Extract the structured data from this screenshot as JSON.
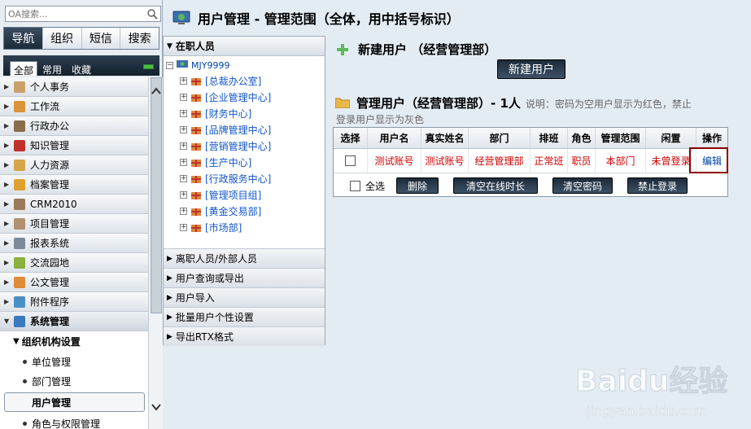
{
  "sidebar": {
    "search_placeholder": "OA搜索...",
    "main_tabs": [
      "导航",
      "组织",
      "短信",
      "搜索"
    ],
    "sub_tabs": [
      "全部",
      "常用",
      "收藏"
    ],
    "menu_items": [
      "个人事务",
      "工作流",
      "行政办公",
      "知识管理",
      "人力资源",
      "档案管理",
      "CRM2010",
      "项目管理",
      "报表系统",
      "交流园地",
      "公文管理",
      "附件程序",
      "系统管理"
    ],
    "sub_header": "组织机构设置",
    "sub_items": [
      "单位管理",
      "部门管理",
      "用户管理",
      "角色与权限管理"
    ]
  },
  "header": {
    "title": "用户管理 - 管理范围（全体，用中括号标识）"
  },
  "tree": {
    "header": "在职人员",
    "root": "MJY9999",
    "depts": [
      "[总裁办公室]",
      "[企业管理中心]",
      "[财务中心]",
      "[品牌管理中心]",
      "[营销管理中心]",
      "[生产中心]",
      "[行政服务中心]",
      "[管理项目组]",
      "[黄金交易部]",
      "[市场部]"
    ],
    "collapsed": [
      "离职人员/外部人员",
      "用户查询或导出",
      "用户导入",
      "批量用户个性设置",
      "导出RTX格式"
    ]
  },
  "new_user": {
    "title": "新建用户 （经营管理部）",
    "button": "新建用户"
  },
  "manage": {
    "title": "管理用户（经营管理部）- 1人",
    "note_line1": "说明：密码为空用户显示为红色，禁止",
    "note_line2": "登录用户显示为灰色",
    "columns": [
      "选择",
      "用户名",
      "真实姓名",
      "部门",
      "排班",
      "角色",
      "管理范围",
      "闲置",
      "操作"
    ],
    "rows": [
      {
        "username": "测试账号",
        "realname": "测试账号",
        "dept": "经营管理部",
        "shift": "正常班",
        "role": "职员",
        "scope": "本部门",
        "idle": "未曾登录",
        "action": "编辑"
      }
    ],
    "select_all": "全选",
    "buttons": [
      "删除",
      "清空在线时长",
      "清空密码",
      "禁止登录"
    ]
  },
  "watermark": {
    "brand": "Baidu经验",
    "url": "jingyan.baidu.com"
  },
  "colors": {
    "nav_dark": "#1c2b3a",
    "red_text": "#d00000",
    "link_blue": "#0044aa",
    "highlight_border": "#8b0000"
  }
}
